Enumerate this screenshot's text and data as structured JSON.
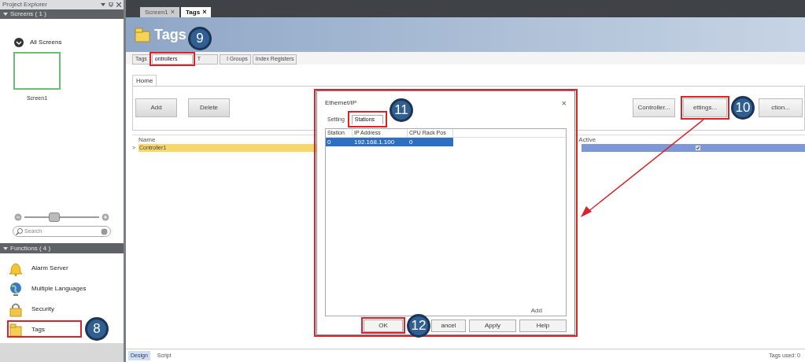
{
  "explorer": {
    "title": "Project Explorer",
    "screens_header": "Screens ( 1 )",
    "all_screens": "All Screens",
    "thumbnails": [
      {
        "label": "Screen1"
      }
    ],
    "zoom": {
      "level": 0.4
    },
    "search": {
      "placeholder": "Search"
    },
    "functions_header": "Functions ( 4 )",
    "functions": [
      {
        "label": "Alarm Server",
        "kind": "bell"
      },
      {
        "label": "Multiple Languages",
        "kind": "globe"
      },
      {
        "label": "Security",
        "kind": "lock"
      },
      {
        "label": "Tags",
        "kind": "tags"
      }
    ]
  },
  "document_tabs": [
    {
      "label": "Screen1",
      "close": "×",
      "selected": false
    },
    {
      "label": "Tags",
      "close": "×",
      "selected": true
    }
  ],
  "header": {
    "title": "Tags"
  },
  "section_tabs": [
    {
      "label": "Tags",
      "selected": false
    },
    {
      "label": "ontrollers",
      "selected": true
    },
    {
      "label": "T",
      "selected": false
    },
    {
      "label": "l Groups",
      "selected": false
    },
    {
      "label": "Index Registers",
      "selected": false
    }
  ],
  "ribbon": {
    "tab": "Home",
    "left_buttons": [
      "Add",
      "Delete"
    ],
    "right_buttons": [
      "Controller...",
      "ettings...",
      "ction..."
    ]
  },
  "grid": {
    "columns": [
      "Name",
      "Active"
    ],
    "rows": [
      {
        "expander": ">",
        "name": "Controller1",
        "active": true
      }
    ]
  },
  "dialog": {
    "title": "Ethernet/IP",
    "close": "×",
    "tabs": [
      {
        "label": "Setting",
        "selected": false
      },
      {
        "label": "Stations",
        "selected": true
      }
    ],
    "columns": [
      "Station",
      "IP Address",
      "CPU Rack Pos"
    ],
    "rows": [
      {
        "cells": [
          "0",
          "192.168.1.100",
          "0"
        ],
        "selected": true
      }
    ],
    "list_buttons": [
      "Add"
    ],
    "buttons": [
      "OK",
      "ancel",
      "Apply",
      "Help"
    ]
  },
  "bottom_tabs": [
    {
      "label": "Design",
      "selected": true
    },
    {
      "label": "Script",
      "selected": false
    }
  ],
  "status": "Tags used: 0",
  "callouts": [
    {
      "number": "8"
    },
    {
      "number": "9"
    },
    {
      "number": "10"
    },
    {
      "number": "11"
    },
    {
      "number": "12"
    }
  ]
}
